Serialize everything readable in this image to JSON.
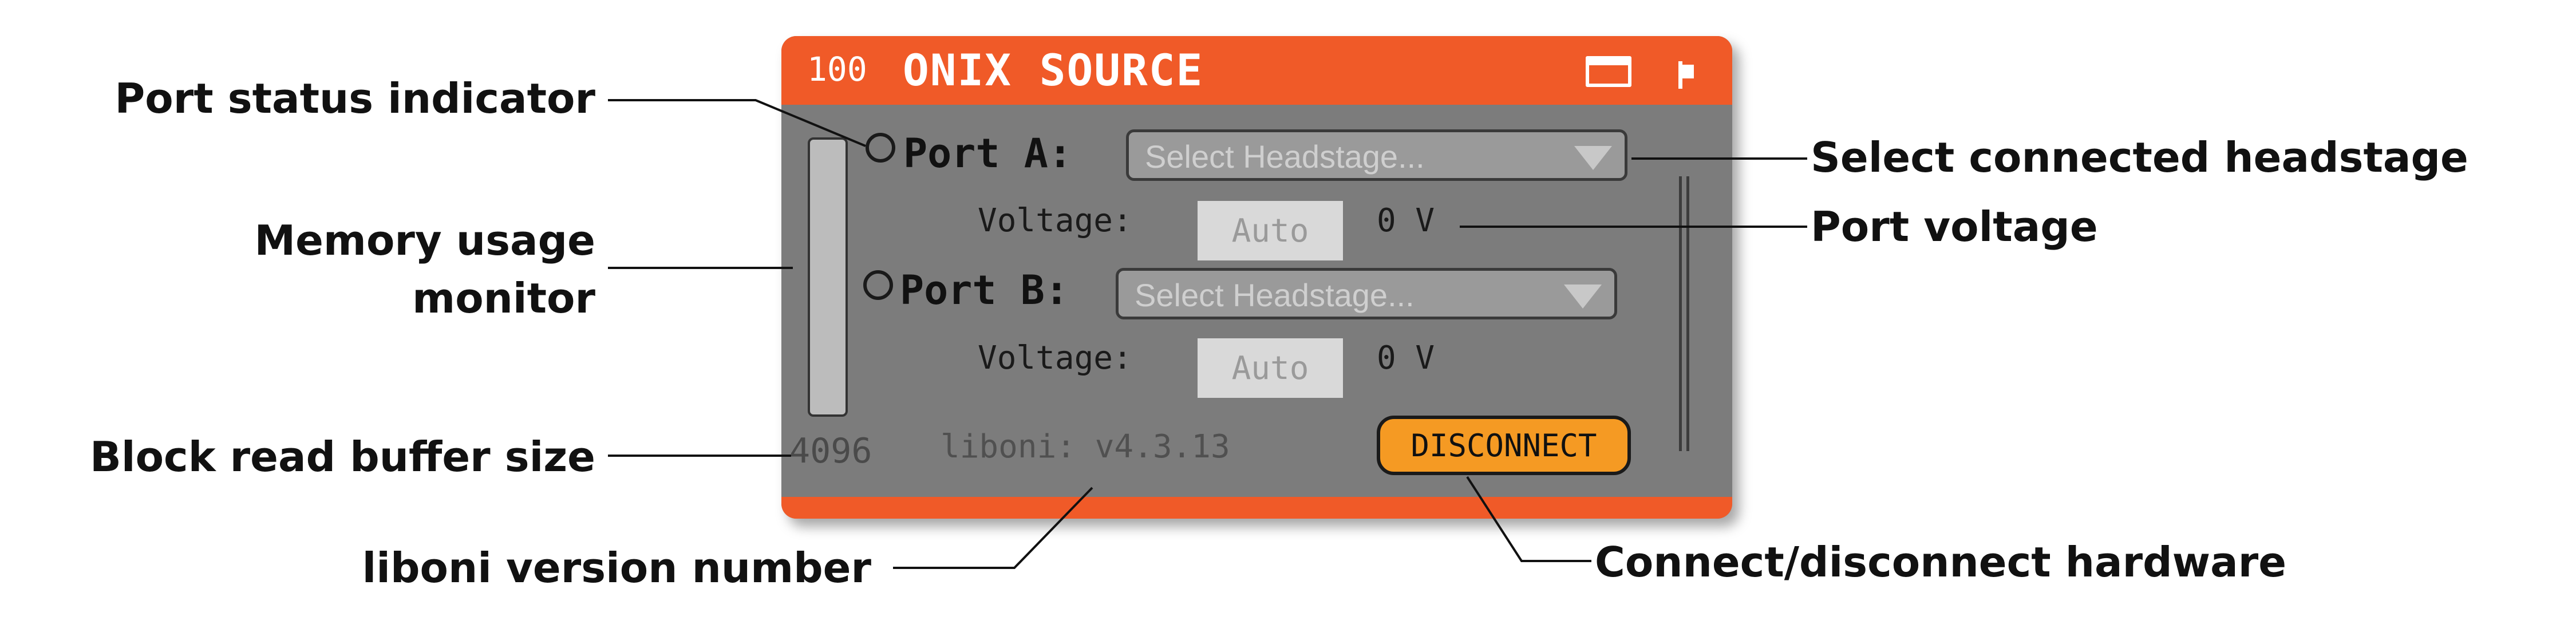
{
  "panel": {
    "title_number": "100",
    "title": "ONIX SOURCE",
    "port_a": {
      "label": "Port A:",
      "headstage_placeholder": "Select Headstage...",
      "voltage_label": "Voltage:",
      "voltage_mode": "Auto",
      "voltage_value": "0 V"
    },
    "port_b": {
      "label": "Port B:",
      "headstage_placeholder": "Select Headstage...",
      "voltage_label": "Voltage:",
      "voltage_mode": "Auto",
      "voltage_value": "0 V"
    },
    "buffer_size": "4096",
    "version": "liboni: v4.3.13",
    "disconnect_label": "DISCONNECT"
  },
  "annotations": {
    "port_status": "Port status indicator",
    "memory_usage_line1": "Memory usage",
    "memory_usage_line2": "monitor",
    "block_read": "Block read buffer size",
    "liboni_version": "liboni version number",
    "select_headstage": "Select connected headstage",
    "port_voltage": "Port voltage",
    "connect_disconnect": "Connect/disconnect hardware"
  },
  "colors": {
    "title_bar": "#f05a28",
    "panel_body": "#7c7c7c",
    "disconnect_button": "#f59a23"
  },
  "icons": [
    "window-icon",
    "flag-icon"
  ]
}
